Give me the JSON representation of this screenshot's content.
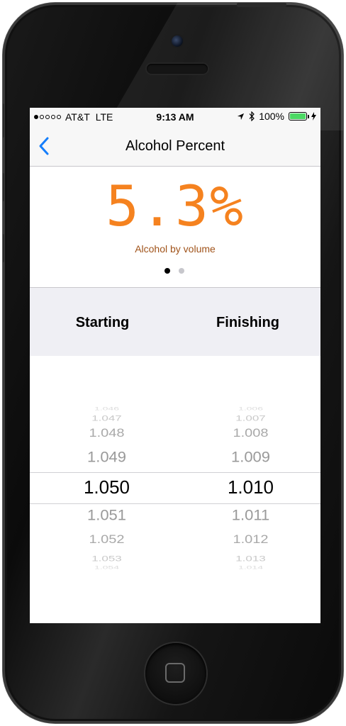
{
  "status_bar": {
    "carrier": "AT&T",
    "network": "LTE",
    "time": "9:13 AM",
    "battery": "100%",
    "signal_bars": 1,
    "battery_level": 1.0,
    "battery_color": "#4cd964"
  },
  "nav": {
    "back_icon": "chevron-left-icon",
    "title": "Alcohol Percent"
  },
  "result": {
    "value": "5.3%",
    "caption": "Alcohol by volume",
    "accent_color": "#f5821f",
    "pages": 2,
    "current_page": 1
  },
  "columns": {
    "starting": "Starting",
    "finishing": "Finishing"
  },
  "picker": {
    "starting": {
      "values": [
        "1.046",
        "1.047",
        "1.048",
        "1.049",
        "1.050",
        "1.051",
        "1.052",
        "1.053",
        "1.054"
      ],
      "selected": "1.050"
    },
    "finishing": {
      "values": [
        "1.006",
        "1.007",
        "1.008",
        "1.009",
        "1.010",
        "1.011",
        "1.012",
        "1.013",
        "1.014"
      ],
      "selected": "1.010"
    }
  }
}
